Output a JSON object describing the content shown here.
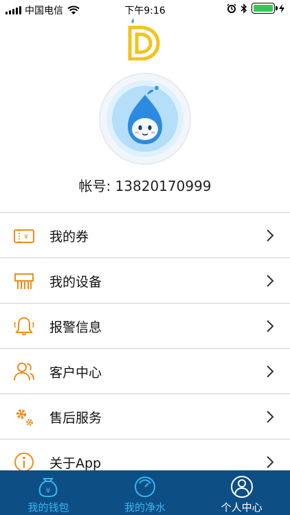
{
  "status_bar": {
    "carrier": "中国电信",
    "time": "下午9:16",
    "battery_level": 1.0
  },
  "profile": {
    "account_label": "帐号: 13820170999"
  },
  "menu": [
    {
      "label": "我的券",
      "icon": "coupon-icon"
    },
    {
      "label": "我的设备",
      "icon": "device-icon"
    },
    {
      "label": "报警信息",
      "icon": "alarm-bell-icon"
    },
    {
      "label": "客户中心",
      "icon": "customer-icon"
    },
    {
      "label": "售后服务",
      "icon": "gear-icon"
    },
    {
      "label": "关于App",
      "icon": "info-icon"
    }
  ],
  "tabs": [
    {
      "label": "我的钱包",
      "icon": "wallet-icon",
      "active": false
    },
    {
      "label": "我的净水",
      "icon": "water-gauge-icon",
      "active": false
    },
    {
      "label": "个人中心",
      "icon": "person-icon",
      "active": true
    }
  ],
  "colors": {
    "accent_orange": "#f08a1c",
    "tabbar_bg": "#0d4e85",
    "tab_inactive": "#35b8f2",
    "tab_active": "#ffffff",
    "logo_yellow": "#f2c31b"
  }
}
